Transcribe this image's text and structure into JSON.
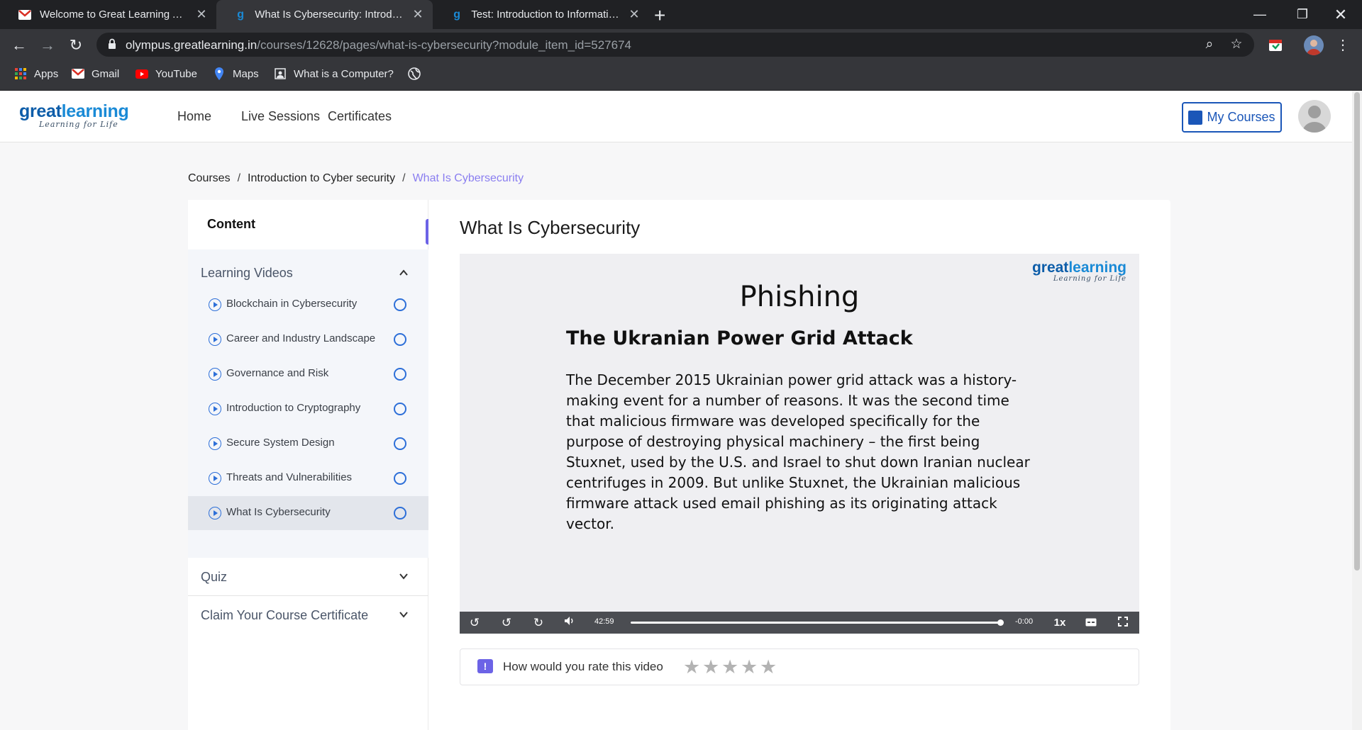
{
  "browser": {
    "tabs": [
      {
        "title": "Welcome to Great Learning Academy",
        "icon": "gmail-icon"
      },
      {
        "title": "What Is Cybersecurity: Introduction to Cyber security",
        "icon": "greatlearning-icon"
      },
      {
        "title": "Test: Introduction to Information Security",
        "icon": "greatlearning-icon"
      }
    ],
    "url_host": "olympus.greatlearning.in",
    "url_path": "/courses/12628/pages/what-is-cybersecurity?module_item_id=527674",
    "bookmarks": [
      {
        "label": "Apps",
        "icon": "apps-grid-icon"
      },
      {
        "label": "Gmail",
        "icon": "gmail-icon"
      },
      {
        "label": "YouTube",
        "icon": "youtube-icon"
      },
      {
        "label": "Maps",
        "icon": "maps-icon"
      },
      {
        "label": "What is a Computer?",
        "icon": "page-icon"
      },
      {
        "label": "",
        "icon": "globe-icon"
      }
    ]
  },
  "site": {
    "logo_word_1": "great",
    "logo_word_2": "learning",
    "logo_tagline": "Learning for Life",
    "nav": [
      "Home",
      "Live Sessions",
      "Certificates"
    ],
    "my_courses": "My Courses"
  },
  "breadcrumb": {
    "items": [
      "Courses",
      "Introduction to Cyber security",
      "What Is Cybersecurity"
    ],
    "separator": "/"
  },
  "sidebar": {
    "heading": "Content",
    "sections": [
      {
        "title": "Learning Videos",
        "expanded": true,
        "items": [
          "Blockchain in Cybersecurity",
          "Career and Industry Landscape",
          "Governance and Risk",
          "Introduction to Cryptography",
          "Secure System Design",
          "Threats and Vulnerabilities",
          "What Is Cybersecurity"
        ],
        "selected_index": 6
      },
      {
        "title": "Quiz",
        "expanded": false
      },
      {
        "title": "Claim Your Course Certificate",
        "expanded": false
      }
    ],
    "collapse_label": "«"
  },
  "main": {
    "title": "What Is Cybersecurity",
    "video": {
      "slide_heading": "Phishing",
      "slide_subheading": "The Ukranian Power Grid Attack",
      "slide_body": "The December 2015 Ukrainian power grid attack was a history-making event for a number of reasons. It was the second time that malicious firmware was developed specifically for the purpose of destroying physical machinery – the first being Stuxnet, used by the U.S. and Israel to shut down Iranian nuclear centrifuges in 2009. But unlike Stuxnet, the Ukrainian malicious firmware attack used email phishing as its originating attack vector.",
      "elapsed": "42:59",
      "remaining": "-0:00",
      "speed": "1x",
      "progress_fraction": 1.0
    },
    "rating": {
      "prompt": "How would you rate this video",
      "stars": 5,
      "rated": 0
    }
  },
  "colors": {
    "accent": "#6c63e6",
    "brand_blue": "#1a56b8",
    "play_blue": "#2d6fd8",
    "breadcrumb_current": "#8a7ef0"
  }
}
